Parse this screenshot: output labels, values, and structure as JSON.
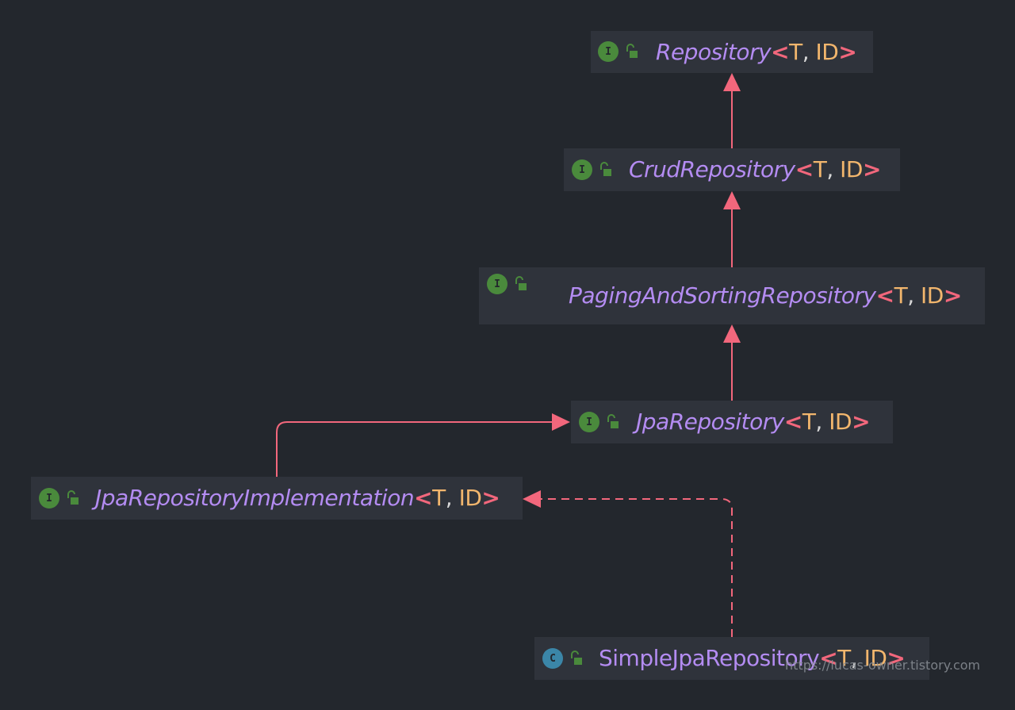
{
  "colors": {
    "background": "#23272d",
    "node_fill": "#2f333b",
    "type_name": "#b48cf2",
    "angle_bracket": "#f2677c",
    "type_param": "#f2b66d",
    "edge": "#f2677c",
    "interface_badge": "#4a8a3c",
    "class_badge": "#3b86a8",
    "lock": "#4a8a3c"
  },
  "nodes": {
    "repository": {
      "name": "Repository",
      "kind": "interface",
      "badge": "I",
      "italic": true,
      "params": [
        "T",
        "ID"
      ],
      "lock_icon": "open-lock-icon"
    },
    "crud": {
      "name": "CrudRepository",
      "kind": "interface",
      "badge": "I",
      "italic": true,
      "params": [
        "T",
        "ID"
      ],
      "lock_icon": "open-lock-icon"
    },
    "paging": {
      "name": "PagingAndSortingRepository",
      "kind": "interface",
      "badge": "I",
      "italic": true,
      "params": [
        "T",
        "ID"
      ],
      "lock_icon": "open-lock-icon"
    },
    "jpa": {
      "name": "JpaRepository",
      "kind": "interface",
      "badge": "I",
      "italic": true,
      "params": [
        "T",
        "ID"
      ],
      "lock_icon": "open-lock-icon"
    },
    "impl": {
      "name": "JpaRepositoryImplementation",
      "kind": "interface",
      "badge": "I",
      "italic": true,
      "params": [
        "T",
        "ID"
      ],
      "lock_icon": "open-lock-icon"
    },
    "simple": {
      "name": "SimpleJpaRepository",
      "kind": "class",
      "badge": "C",
      "italic": false,
      "params": [
        "T",
        "ID"
      ],
      "lock_icon": "open-lock-icon"
    }
  },
  "edges": [
    {
      "from": "crud",
      "to": "repository",
      "type": "extends"
    },
    {
      "from": "paging",
      "to": "crud",
      "type": "extends"
    },
    {
      "from": "jpa",
      "to": "paging",
      "type": "extends"
    },
    {
      "from": "impl",
      "to": "jpa",
      "type": "extends"
    },
    {
      "from": "simple",
      "to": "impl",
      "type": "implements"
    }
  ],
  "watermark": "https://lucas-owner.tistory.com"
}
